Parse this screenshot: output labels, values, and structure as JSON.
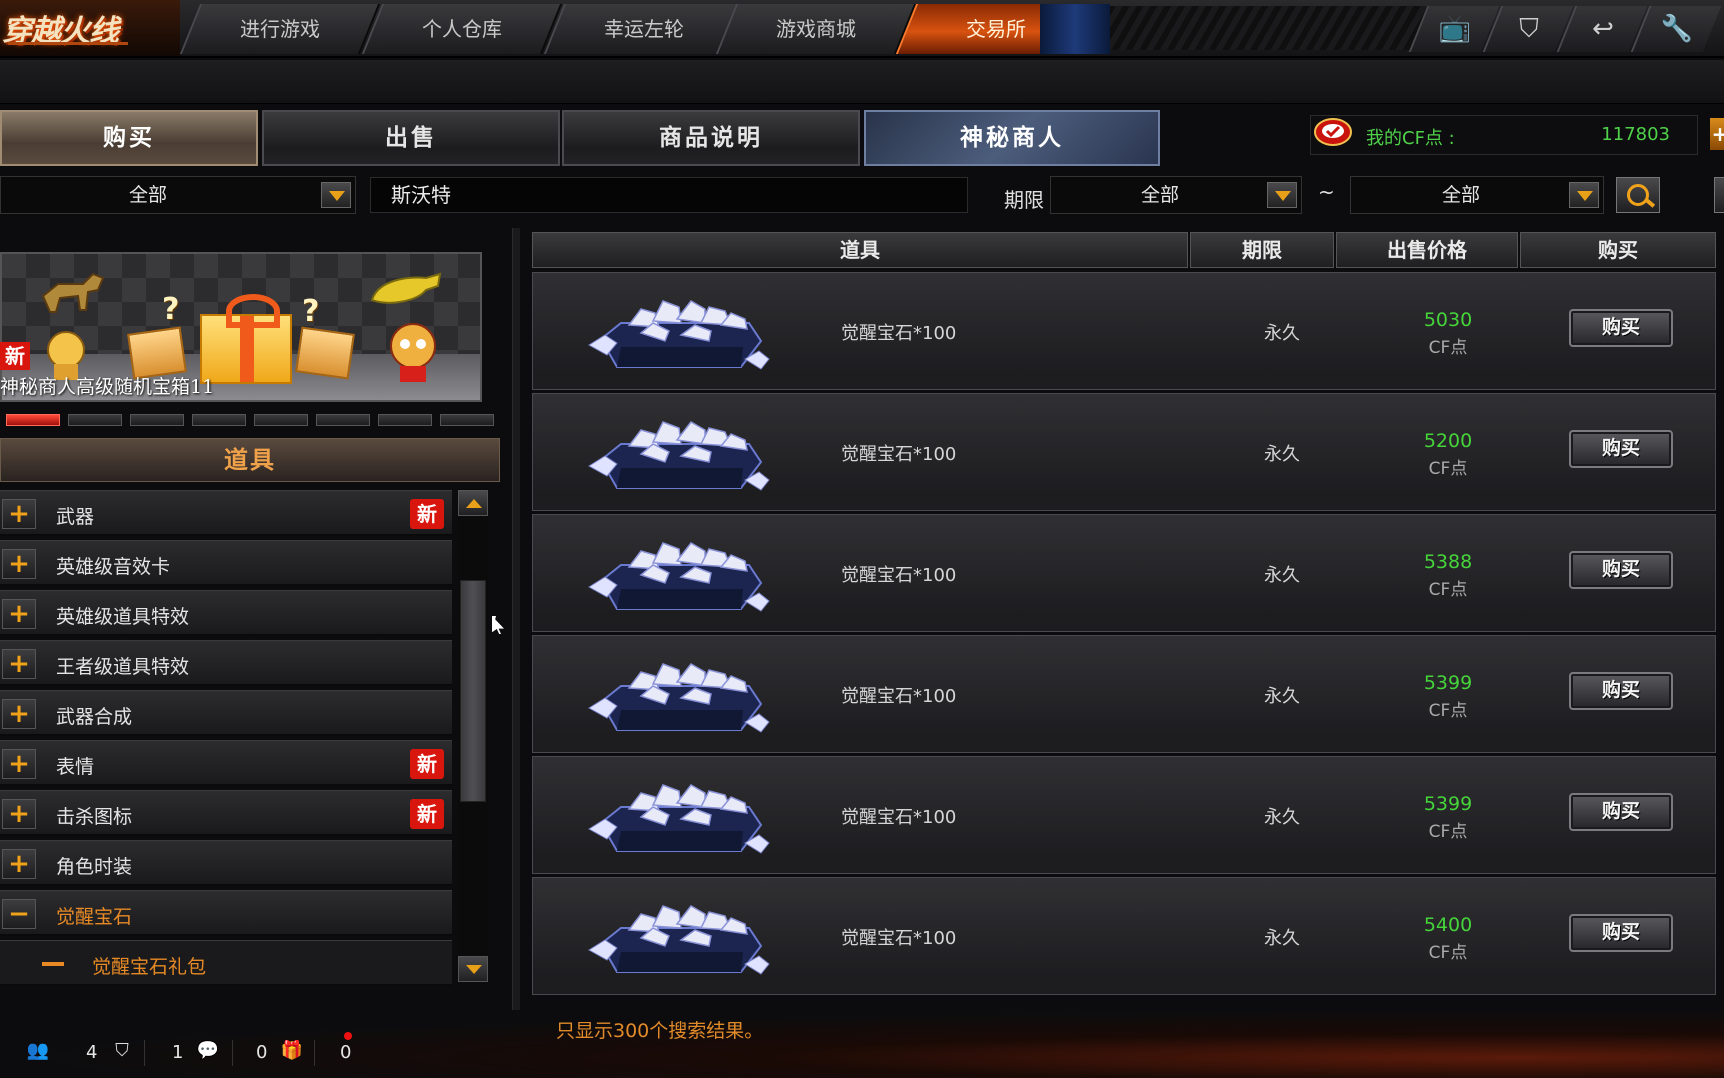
{
  "nav": {
    "logo": "穿越火线",
    "tabs": [
      "进行游戏",
      "个人仓库",
      "幸运左轮",
      "游戏商城",
      "交易所"
    ],
    "active_tab": "交易所",
    "icons": [
      "tv-icon",
      "shield-icon",
      "return-icon",
      "wrench-icon"
    ]
  },
  "sections": [
    "购买",
    "出售",
    "商品说明",
    "神秘商人"
  ],
  "cf": {
    "label": "我的CF点 :",
    "value": "117803"
  },
  "filters": {
    "category": "全部",
    "keyword": "斯沃特",
    "period_label": "期限",
    "period_from": "全部",
    "tilde": "~",
    "period_to": "全部"
  },
  "banner": {
    "new_badge": "新",
    "title": "神秘商人高级随机宝箱11",
    "page_count": 8,
    "active_page": 0
  },
  "category_header": "道具",
  "categories": [
    {
      "label": "武器",
      "new": "新",
      "open": false
    },
    {
      "label": "英雄级音效卡",
      "open": false
    },
    {
      "label": "英雄级道具特效",
      "open": false
    },
    {
      "label": "王者级道具特效",
      "open": false
    },
    {
      "label": "武器合成",
      "open": false
    },
    {
      "label": "表情",
      "new": "新",
      "open": false
    },
    {
      "label": "击杀图标",
      "new": "新",
      "open": false
    },
    {
      "label": "角色时装",
      "open": false
    },
    {
      "label": "觉醒宝石",
      "open": true
    },
    {
      "label": "觉醒宝石礼包",
      "sub": true
    }
  ],
  "table": {
    "headers": [
      "道具",
      "期限",
      "出售价格",
      "购买"
    ],
    "rows": [
      {
        "name": "觉醒宝石*100",
        "duration": "永久",
        "price": "5030",
        "unit": "CF点",
        "button": "购买"
      },
      {
        "name": "觉醒宝石*100",
        "duration": "永久",
        "price": "5200",
        "unit": "CF点",
        "button": "购买"
      },
      {
        "name": "觉醒宝石*100",
        "duration": "永久",
        "price": "5388",
        "unit": "CF点",
        "button": "购买"
      },
      {
        "name": "觉醒宝石*100",
        "duration": "永久",
        "price": "5399",
        "unit": "CF点",
        "button": "购买"
      },
      {
        "name": "觉醒宝石*100",
        "duration": "永久",
        "price": "5399",
        "unit": "CF点",
        "button": "购买"
      },
      {
        "name": "觉醒宝石*100",
        "duration": "永久",
        "price": "5400",
        "unit": "CF点",
        "button": "购买"
      }
    ]
  },
  "notice": "只显示300个搜索结果。",
  "status": {
    "friends": "4",
    "clan": "1",
    "messages": "0",
    "gifts": "0"
  },
  "colors": {
    "accent": "#e78a25",
    "price": "#45d43a",
    "new_badge": "#d8160e"
  }
}
